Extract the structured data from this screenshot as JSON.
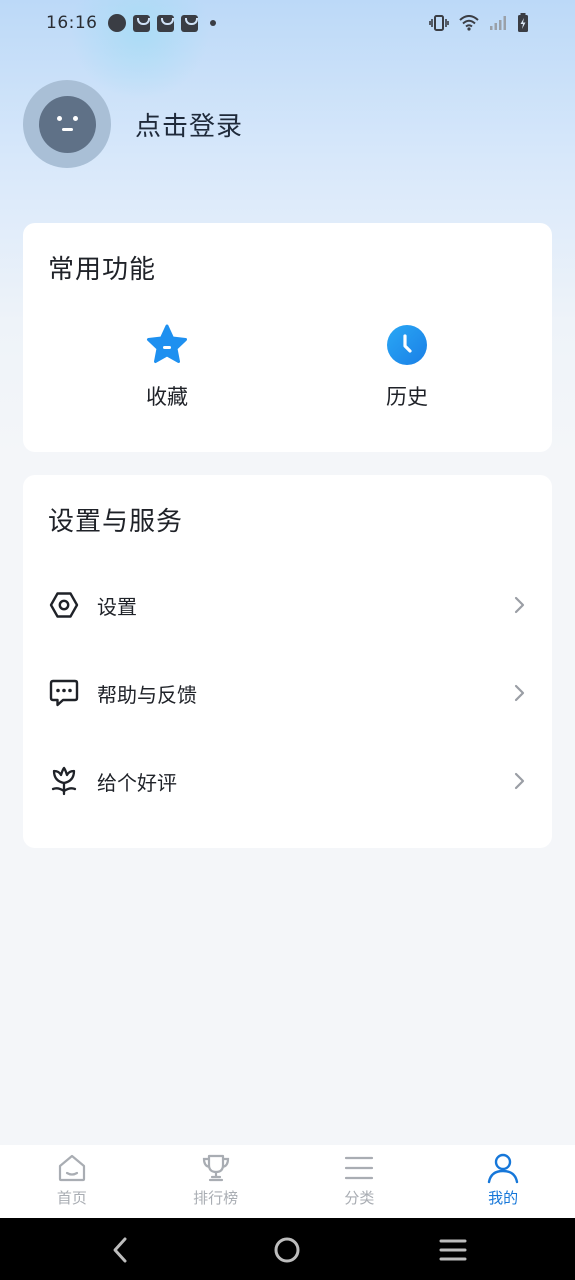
{
  "status_bar": {
    "time": "16:16"
  },
  "profile": {
    "login_text": "点击登录"
  },
  "common_functions": {
    "title": "常用功能",
    "items": [
      {
        "label": "收藏",
        "icon": "star-icon"
      },
      {
        "label": "历史",
        "icon": "clock-icon"
      }
    ]
  },
  "settings_services": {
    "title": "设置与服务",
    "items": [
      {
        "label": "设置",
        "icon": "hexagon-settings-icon"
      },
      {
        "label": "帮助与反馈",
        "icon": "chat-bubble-icon"
      },
      {
        "label": "给个好评",
        "icon": "flower-icon"
      }
    ]
  },
  "bottom_nav": {
    "items": [
      {
        "label": "首页",
        "icon": "home-icon",
        "active": false
      },
      {
        "label": "排行榜",
        "icon": "trophy-icon",
        "active": false
      },
      {
        "label": "分类",
        "icon": "list-icon",
        "active": false
      },
      {
        "label": "我的",
        "icon": "user-icon",
        "active": true
      }
    ]
  },
  "colors": {
    "accent": "#1677d9",
    "icon_blue": "#1e90f0",
    "inactive": "#a9adb3",
    "card_bg": "#ffffff",
    "page_bg": "#f4f6f9"
  }
}
